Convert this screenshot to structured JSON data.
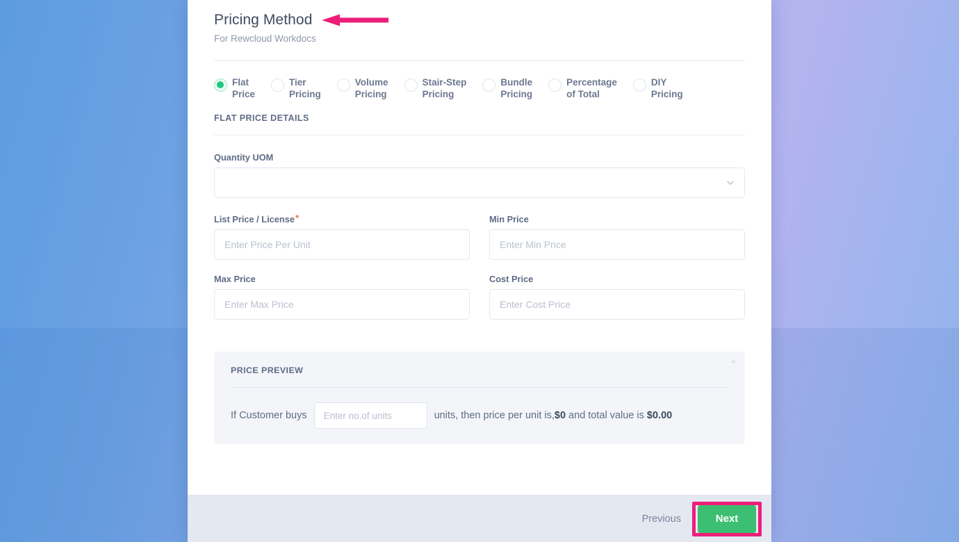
{
  "theme": {
    "accent_green": "#3cbf72",
    "radio_selected": "#1fc77f",
    "annotation_pink": "#ed1e79",
    "required_star": "#f5713c",
    "text_primary": "#3d4a61",
    "text_secondary": "#5f6b85",
    "placeholder": "#b9c0ce",
    "footer_bg": "#e3e8f1",
    "preview_bg": "#f3f5f9"
  },
  "modal": {
    "title": "Pricing Method",
    "subtitle": "For Rewcloud Workdocs"
  },
  "annotations": {
    "title_arrow": "left-arrow-pointing-to-title",
    "next_highlight": "highlight-box-around-next-button"
  },
  "pricing_methods": {
    "selected": "Flat Price",
    "options": [
      {
        "label": "Flat\nPrice",
        "value": "flat-price",
        "selected": true
      },
      {
        "label": "Tier\nPricing",
        "value": "tier-pricing",
        "selected": false
      },
      {
        "label": "Volume\nPricing",
        "value": "volume-pricing",
        "selected": false
      },
      {
        "label": "Stair-Step\nPricing",
        "value": "stair-step-pricing",
        "selected": false
      },
      {
        "label": "Bundle\nPricing",
        "value": "bundle-pricing",
        "selected": false
      },
      {
        "label": "Percentage\nof Total",
        "value": "percentage-of-total",
        "selected": false
      },
      {
        "label": "DIY\nPricing",
        "value": "diy-pricing",
        "selected": false
      }
    ]
  },
  "details": {
    "section_title": "FLAT PRICE DETAILS",
    "quantity_uom": {
      "label": "Quantity UOM",
      "value": "",
      "placeholder": "",
      "icon": "chevron-down-icon"
    },
    "list_price": {
      "label": "List Price / License",
      "required_marker": "*",
      "value": "",
      "placeholder": "Enter Price Per Unit"
    },
    "min_price": {
      "label": "Min Price",
      "value": "",
      "placeholder": "Enter Min Price"
    },
    "max_price": {
      "label": "Max Price",
      "value": "",
      "placeholder": "Enter Max Price"
    },
    "cost_price": {
      "label": "Cost Price",
      "value": "",
      "placeholder": "Enter Cost Price"
    }
  },
  "price_preview": {
    "title": "PRICE PREVIEW",
    "sentence_start": "If Customer buys",
    "units_input": {
      "value": "",
      "placeholder": "Enter no.of units"
    },
    "sentence_middle": "units, then price per unit is,",
    "price_per_unit": "$0",
    "sentence_end": " and total value is ",
    "total_value": "$0.00"
  },
  "footer": {
    "previous_label": "Previous",
    "next_label": "Next"
  }
}
